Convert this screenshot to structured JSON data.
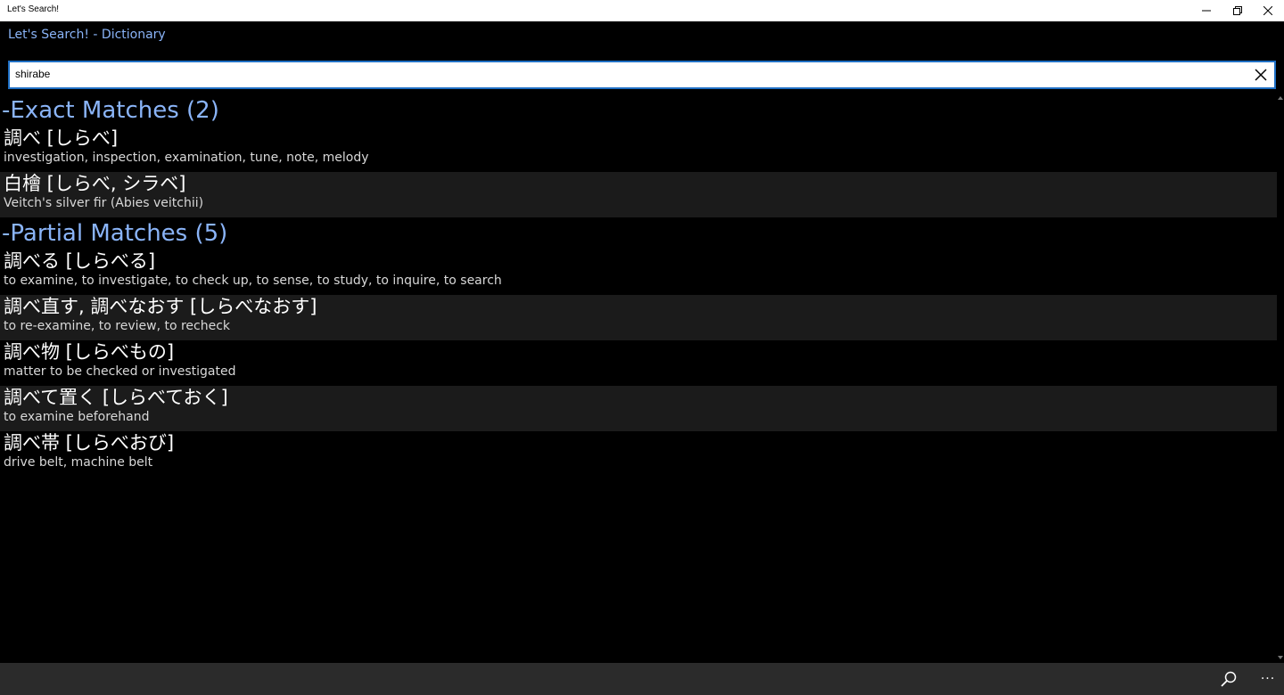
{
  "window": {
    "title": "Let's Search!"
  },
  "app": {
    "title": "Let's Search! - Dictionary"
  },
  "search": {
    "value": "shirabe",
    "placeholder": ""
  },
  "groups": [
    {
      "header": "-Exact Matches (2)",
      "entries": [
        {
          "term": "調べ [しらべ]",
          "meaning": "investigation, inspection, examination, tune, note, melody"
        },
        {
          "term": "白檜 [しらべ, シラベ]",
          "meaning": "Veitch's silver fir (Abies veitchii)"
        }
      ]
    },
    {
      "header": "-Partial Matches (5)",
      "entries": [
        {
          "term": "調べる [しらべる]",
          "meaning": "to examine, to investigate, to check up, to sense, to study, to inquire, to search"
        },
        {
          "term": "調べ直す, 調べなおす [しらべなおす]",
          "meaning": "to re-examine, to review, to recheck"
        },
        {
          "term": "調べ物 [しらべもの]",
          "meaning": "matter to be checked or investigated"
        },
        {
          "term": "調べて置く [しらべておく]",
          "meaning": "to examine beforehand"
        },
        {
          "term": "調べ帯 [しらべおび]",
          "meaning": "drive belt, machine belt"
        }
      ]
    }
  ],
  "appbar": {
    "more_label": "···"
  },
  "colors": {
    "accent": "#8ab4f8",
    "row_alt": "#1b1b1b",
    "appbar": "#2b2b2b",
    "focus_border": "#1f6fc4"
  }
}
